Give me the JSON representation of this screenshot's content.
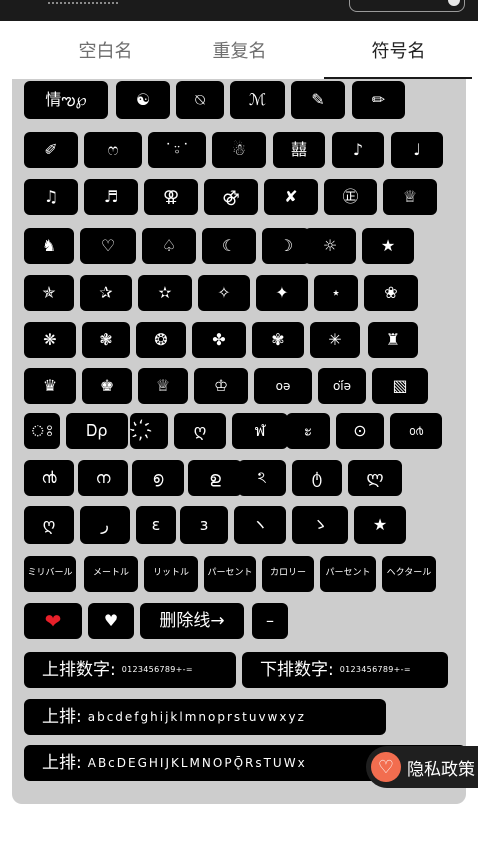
{
  "tabs": [
    {
      "label": "空白名"
    },
    {
      "label": "重复名"
    },
    {
      "label": "符号名"
    }
  ],
  "active_tab": "符号名",
  "symbols": [
    [
      "情ఌ℘",
      "☯",
      "⍉",
      "ℳ",
      "✎",
      "✏"
    ],
    [
      "✐",
      "ෆ",
      "˙⍤˙",
      "☃",
      "囍",
      "♪",
      "♩"
    ],
    [
      "♫",
      "♬",
      "⚢",
      "⚣",
      "✘",
      "㊣",
      "♕"
    ],
    [
      "♞",
      "♡",
      "♤",
      "☾",
      "☽",
      "☼",
      "★"
    ],
    [
      "✯",
      "✰",
      "✫",
      "✧",
      "✦",
      "⋆",
      "❀"
    ],
    [
      "❋",
      "❃",
      "❂",
      "✤",
      "✾",
      "✳",
      "♜"
    ],
    [
      "♛",
      "♚",
      "♕",
      "♔",
      "oə",
      "oí̈ə",
      "▧"
    ],
    [
      "ঃ",
      "Ꭰρ",
      "҉",
      "ღ",
      "ฬ",
      "ะ",
      "⊙",
      "൦൪"
    ],
    [
      "൯",
      "ന",
      "൭",
      "ഉ",
      "ঽ",
      "ტ",
      "ლ"
    ],
    [
      "ღ",
      "ر",
      "ε",
      "з",
      "ヽ",
      "ゝ",
      "★"
    ],
    [
      "ミリバール",
      "メートル",
      "リットル",
      "パーセント",
      "カロリー",
      "パーセント",
      "ヘクタール"
    ],
    [
      "❤",
      "♥",
      "删除线→",
      "–"
    ]
  ],
  "lines": {
    "upper_digits_label": "上排数字:",
    "upper_digits": "0123456789+-=",
    "lower_digits_label": "下排数字:",
    "lower_digits": "0123456789+-=",
    "upper_lower_label": "上排:",
    "upper_lower": "abcdefghijklmnoprstuvwxyz",
    "upper_caps_label": "上排:",
    "upper_caps": "ABcDEGHIJKLMNOPǬRsTUWx"
  },
  "privacy_button": {
    "label": "隐私政策",
    "icon": "heart-in-circle-icon"
  }
}
